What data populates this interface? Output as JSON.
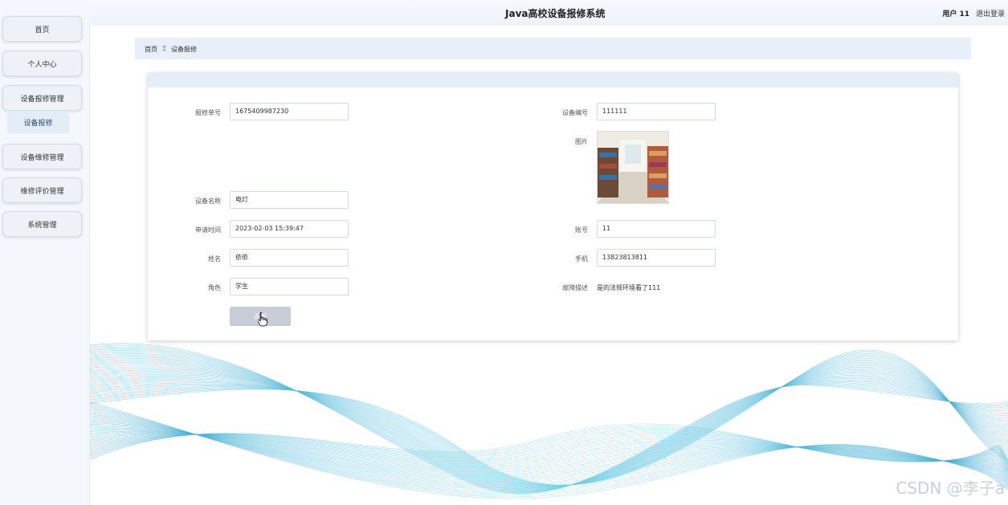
{
  "header": {
    "title": "Java高校设备报修系统",
    "user": "用户 11",
    "logout": "退出登录"
  },
  "sidebar": {
    "items": [
      "首页",
      "个人中心",
      "设备报修管理",
      "设备维修管理",
      "维修评价管理",
      "系统管理"
    ],
    "sub_item": "设备报修"
  },
  "breadcrumb": {
    "home": "首页",
    "sep": "Ξ",
    "current": "设备报修"
  },
  "form": {
    "repair_no_label": "报修单号",
    "repair_no": "1675409987230",
    "device_no_label": "设备编号",
    "device_no": "111111",
    "image_label": "图片",
    "device_name_label": "设备名称",
    "device_name": "电灯",
    "apply_time_label": "申请时间",
    "apply_time": "2023-02-03 15:39:47",
    "account_label": "账号",
    "account": "11",
    "name_label": "姓名",
    "name": "依依",
    "phone_label": "手机",
    "phone": "13823813811",
    "role_label": "角色",
    "role": "学生",
    "fault_label": "故障描述",
    "fault": "是的法规环境看了111",
    "back_button": "返回"
  },
  "watermark": "CSDN @李子a",
  "colors": {
    "accent_wave": "#4fb8d8",
    "panel_header": "#e4eef9",
    "button": "#c6cdd6"
  }
}
